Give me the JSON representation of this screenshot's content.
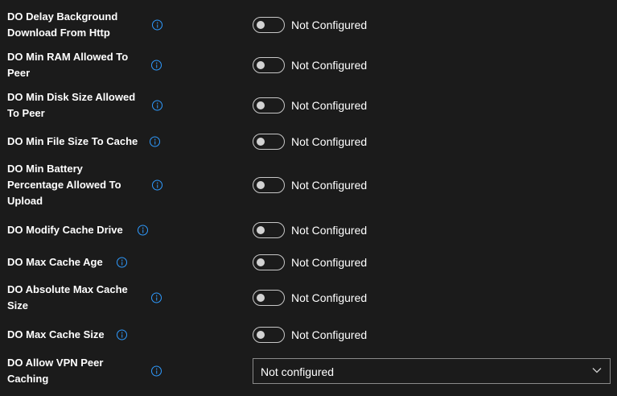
{
  "settings": [
    {
      "label": "DO Delay Background Download From Http",
      "value": "Not Configured"
    },
    {
      "label": "DO Min RAM Allowed To Peer",
      "value": "Not Configured"
    },
    {
      "label": "DO Min Disk Size Allowed To Peer",
      "value": "Not Configured"
    },
    {
      "label": "DO Min File Size To Cache",
      "value": "Not Configured"
    },
    {
      "label": "DO Min Battery Percentage Allowed To Upload",
      "value": "Not Configured"
    },
    {
      "label": "DO Modify Cache Drive",
      "value": "Not Configured"
    },
    {
      "label": "DO Max Cache Age",
      "value": "Not Configured"
    },
    {
      "label": "DO Absolute Max Cache Size",
      "value": "Not Configured"
    },
    {
      "label": "DO Max Cache Size",
      "value": "Not Configured"
    },
    {
      "label": "DO Allow VPN Peer Caching",
      "value": "Not configured"
    }
  ],
  "colors": {
    "background": "#1b1b1b",
    "info_icon": "#2f9bff",
    "text": "#ffffff"
  }
}
